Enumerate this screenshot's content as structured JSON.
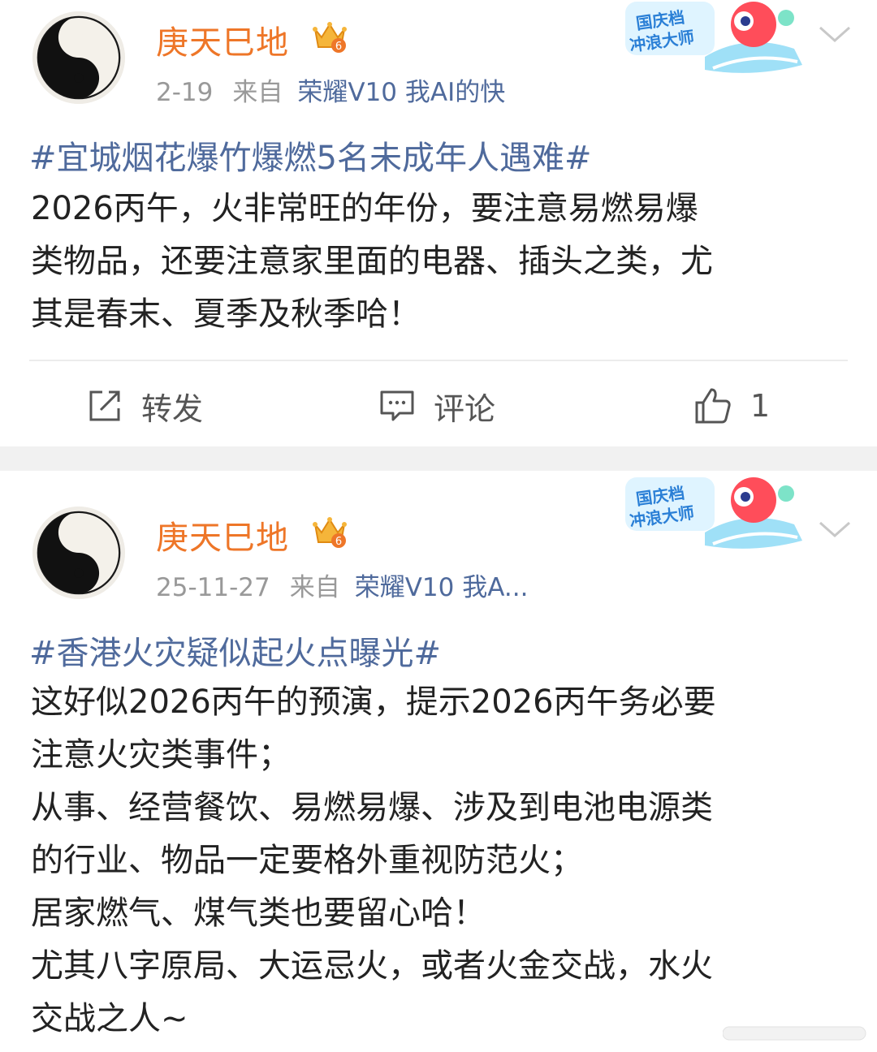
{
  "posts": [
    {
      "author": "庚天巳地",
      "date": "2-19",
      "from_label": "来自",
      "source": "荣耀V10 我AI的快",
      "hashtag": "#宜城烟花爆竹爆燃5名未成年人遇难#",
      "lines": [
        "2026丙午，火非常旺的年份，要注意易燃易爆",
        "类物品，还要注意家里面的电器、插头之类，尤",
        "其是春末、夏季及秋季哈！"
      ],
      "actions": {
        "repost": "转发",
        "comment": "评论",
        "like_count": "1"
      },
      "badge": [
        "国庆档",
        "冲浪大师"
      ],
      "level": "6"
    },
    {
      "author": "庚天巳地",
      "date": "25-11-27",
      "from_label": "来自",
      "source": "荣耀V10 我A...",
      "hashtag": "#香港火灾疑似起火点曝光#",
      "lines": [
        "这好似2026丙午的预演，提示2026丙午务必要",
        "注意火灾类事件；",
        "从事、经营餐饮、易燃易爆、涉及到电池电源类",
        "的行业、物品一定要格外重视防范火；",
        "居家燃气、煤气类也要留心哈！",
        "尤其八字原局、大运忌火，或者火金交战，水火",
        "交战之人~"
      ],
      "badge": [
        "国庆档",
        "冲浪大师"
      ],
      "level": "6"
    }
  ],
  "icons": {
    "avatar": "yin-yang-avatar",
    "crown": "crown-level-icon",
    "badge": "surf-master-badge",
    "more": "chevron-down-icon",
    "repost": "share-square-icon",
    "comment": "comment-icon",
    "like": "thumbs-up-icon"
  },
  "colors": {
    "name": "#ee7628",
    "link": "#4f6a9c",
    "text": "#222222",
    "meta": "#999999",
    "separator": "#f1f1f1"
  }
}
